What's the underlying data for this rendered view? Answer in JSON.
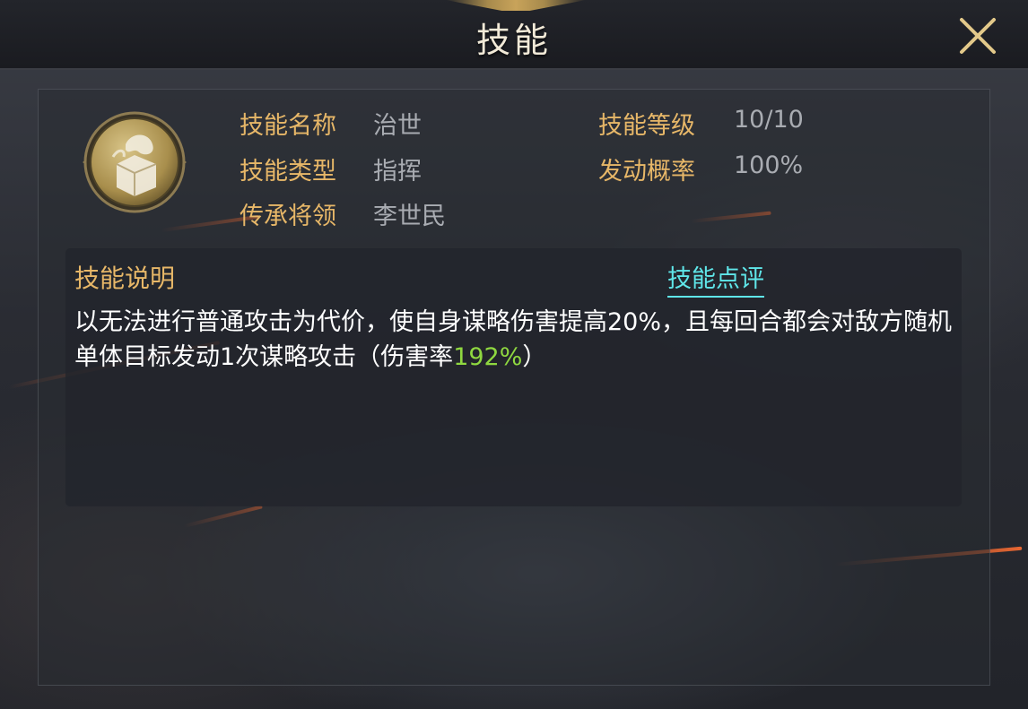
{
  "header": {
    "title": "技能"
  },
  "skill": {
    "fields": {
      "name_label": "技能名称",
      "name_value": "治世",
      "level_label": "技能等级",
      "level_value": "10/10",
      "type_label": "技能类型",
      "type_value": "指挥",
      "rate_label": "发动概率",
      "rate_value": "100%",
      "heir_label": "传承将领",
      "heir_value": "李世民"
    },
    "icon": "dragon-emblem-icon"
  },
  "description": {
    "title": "技能说明",
    "review_link": "技能点评",
    "text_before": "以无法进行普通攻击为代价，使自身谋略伤害提高20%，且每回合都会对敌方随机单体目标发动1次谋略攻击（伤害率",
    "highlight": "192%",
    "text_after": "）"
  },
  "colors": {
    "label": "#e7b768",
    "value": "#a9acb2",
    "highlight": "#8fd840",
    "link": "#5fe6e9"
  }
}
